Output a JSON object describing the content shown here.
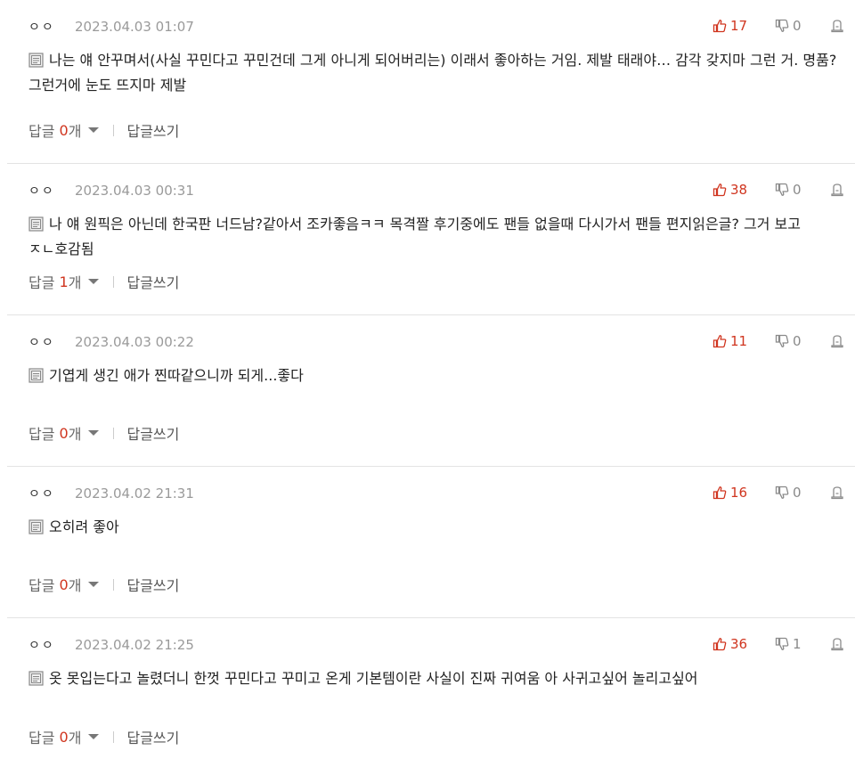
{
  "colors": {
    "accent": "#d0351f",
    "muted": "#9a9a9a",
    "divider": "#e3e3e3"
  },
  "labels": {
    "reply": "답글",
    "count_suffix": "개",
    "write_reply": "답글쓰기"
  },
  "icons": {
    "up": "thumbs-up-icon",
    "down": "thumbs-down-icon",
    "report": "report-icon",
    "memo": "memo-icon",
    "caret": "caret-down-icon"
  },
  "comments": [
    {
      "nick": "ㅇㅇ",
      "date": "2023.04.03 01:07",
      "up": "17",
      "down": "0",
      "text": "나는 얘 안꾸며서(사실 꾸민다고 꾸민건데 그게 아니게 되어버리는) 이래서 좋아하는 거임. 제발 태래야… 감각 갖지마 그런 거. 명품? 그런거에 눈도 뜨지마 제발",
      "reply_count": "0"
    },
    {
      "nick": "ㅇㅇ",
      "date": "2023.04.03 00:31",
      "up": "38",
      "down": "0",
      "text": "나 얘 원픽은 아닌데 한국판 너드남?같아서 조카좋음ㅋㅋ 목격짤 후기중에도 팬들 없을때 다시가서 팬들 편지읽은글? 그거 보고 ㅈㄴ호감됨",
      "reply_count": "1"
    },
    {
      "nick": "ㅇㅇ",
      "date": "2023.04.03 00:22",
      "up": "11",
      "down": "0",
      "text": "기엽게 생긴 애가 찐따같으니까 되게...좋다",
      "reply_count": "0"
    },
    {
      "nick": "ㅇㅇ",
      "date": "2023.04.02 21:31",
      "up": "16",
      "down": "0",
      "text": "오히려 좋아",
      "reply_count": "0"
    },
    {
      "nick": "ㅇㅇ",
      "date": "2023.04.02 21:25",
      "up": "36",
      "down": "1",
      "text": "옷 못입는다고 놀렸더니 한껏 꾸민다고 꾸미고 온게 기본템이란 사실이 진짜 귀여움 아 사귀고싶어 놀리고싶어",
      "reply_count": "0"
    }
  ]
}
